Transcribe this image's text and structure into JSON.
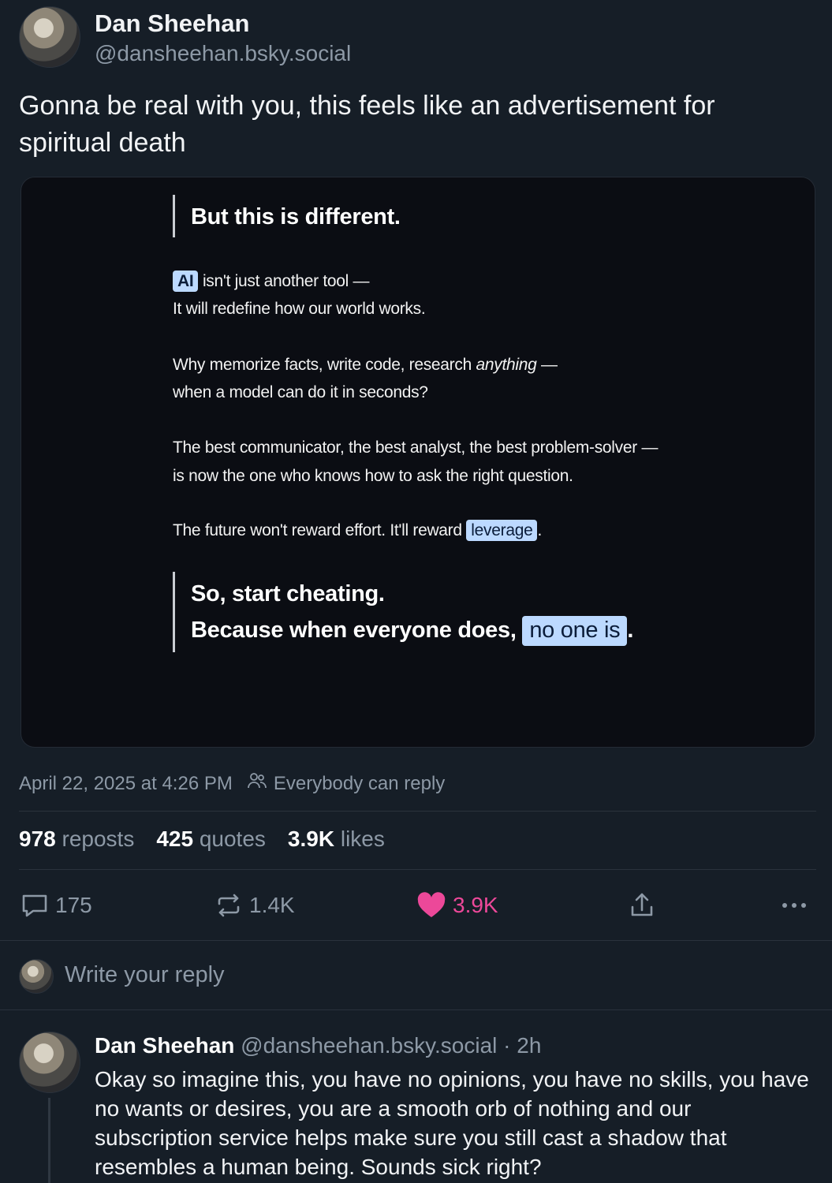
{
  "post": {
    "author_name": "Dan Sheehan",
    "handle": "@dansheehan.bsky.social",
    "text": "Gonna be real with you, this feels like an advertisement for spiritual death"
  },
  "embedded_image": {
    "heading": "But this is different.",
    "p1_tag": "AI",
    "p1_rest": " isn't just another tool —",
    "p1_line2": "It will redefine how our world works.",
    "p2_start": "Why memorize facts, write code, research ",
    "p2_em": "anything",
    "p2_end": " —",
    "p2_line2": "when a model can do it in seconds?",
    "p3_line1": "The best communicator, the best analyst, the best problem-solver —",
    "p3_line2": "is now the one who knows how to ask the right question.",
    "p4_start": "The future won't reward effort. It'll reward ",
    "p4_tag": "leverage",
    "p4_end": ".",
    "closing_line1": "So, start cheating.",
    "closing_line2_start": "Because when everyone does, ",
    "closing_tag": "no one is",
    "closing_end": "."
  },
  "meta": {
    "timestamp": "April 22, 2025 at 4:26 PM",
    "reply_setting": "Everybody can reply"
  },
  "stats": {
    "reposts_count": "978",
    "reposts_label": "reposts",
    "quotes_count": "425",
    "quotes_label": "quotes",
    "likes_count": "3.9K",
    "likes_label": "likes"
  },
  "actions": {
    "reply_count": "175",
    "repost_count": "1.4K",
    "like_count": "3.9K"
  },
  "reply_box": {
    "placeholder": "Write your reply"
  },
  "comment": {
    "author_name": "Dan Sheehan",
    "handle": "@dansheehan.bsky.social",
    "time": "· 2h",
    "text": "Okay so imagine this, you have no opinions, you have no skills, you have no wants or desires, you are a smooth orb of nothing and our subscription service helps make sure you still cast a shadow that resembles a human being. Sounds sick right?"
  },
  "colors": {
    "background": "#161e27",
    "card_background": "#0b0d13",
    "like_accent": "#ec4899",
    "tag_highlight": "#bcd9ff",
    "muted_text": "#8d99a6"
  },
  "icons": [
    "reply-icon",
    "repost-icon",
    "heart-icon",
    "share-icon",
    "more-icon",
    "people-icon"
  ]
}
